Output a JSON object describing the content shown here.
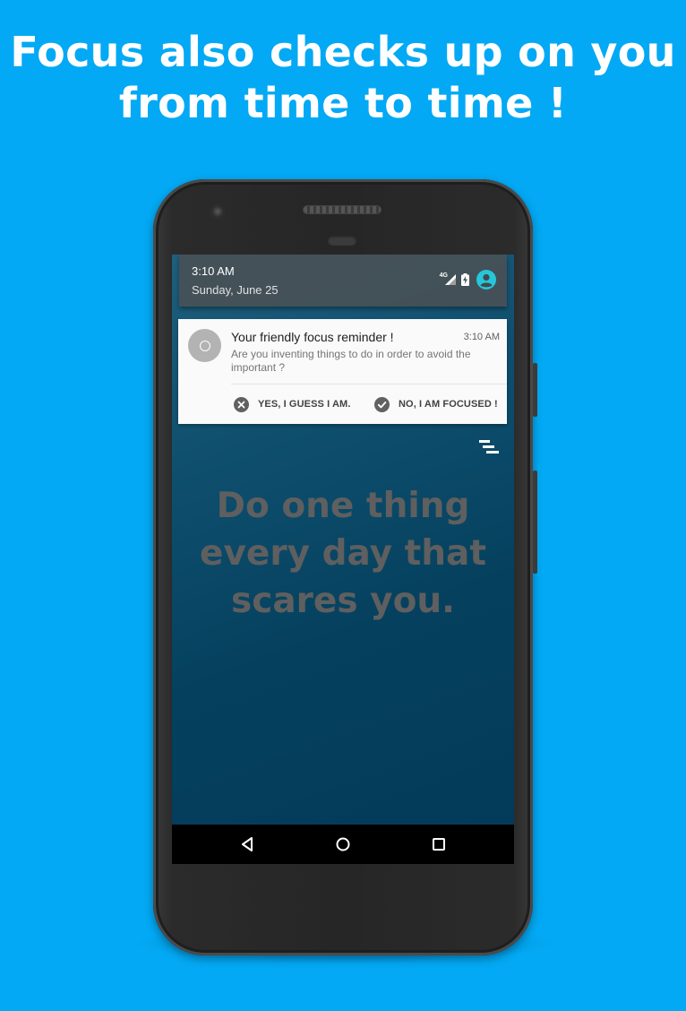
{
  "headline": {
    "line1": "Focus also checks up on you",
    "line2": "from time to time !"
  },
  "status_panel": {
    "time": "3:10 AM",
    "date": "Sunday, June 25",
    "network_type": "4G"
  },
  "notification": {
    "title": "Your friendly focus reminder !",
    "time": "3:10 AM",
    "body": "Are you inventing things to do in order to avoid the important ?",
    "actions": [
      {
        "label": "YES, I GUESS I AM.",
        "icon": "cancel-circle-icon"
      },
      {
        "label": "NO, I AM FOCUSED !",
        "icon": "check-circle-icon"
      }
    ]
  },
  "quote": {
    "line1": "Do one thing",
    "line2": "every day that",
    "line3": "scares you."
  },
  "navbar": {
    "buttons": [
      "back",
      "home",
      "recents"
    ]
  },
  "colors": {
    "background": "#03a9f4",
    "screen": "#023a58",
    "quote_text": "#5f5f5f",
    "accent": "#26c6da"
  }
}
